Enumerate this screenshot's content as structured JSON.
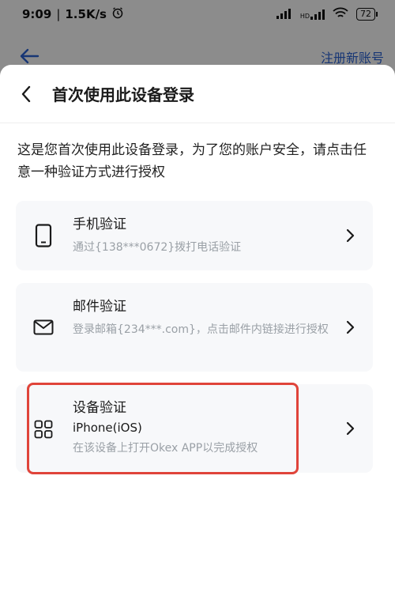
{
  "status_bar": {
    "time": "9:09",
    "speed": "1.5K/s",
    "battery": "72",
    "network": "HD"
  },
  "background": {
    "register_link": "注册新账号"
  },
  "sheet": {
    "title": "首次使用此设备登录",
    "description": "这是您首次使用此设备登录，为了您的账户安全，请点击任意一种验证方式进行授权",
    "options": [
      {
        "title": "手机验证",
        "subtitle": "通过{138***0672}拨打电话验证",
        "icon": "phone-icon"
      },
      {
        "title": "邮件验证",
        "subtitle": "登录邮箱{234***.com}，点击邮件内链接进行授权",
        "icon": "mail-icon"
      },
      {
        "title": "设备验证",
        "device": "iPhone(iOS)",
        "subtitle": "在该设备上打开Okex APP以完成授权",
        "icon": "grid-icon"
      }
    ]
  },
  "colors": {
    "accent": "#2a63d6",
    "highlight": "#e0443a",
    "card_bg": "#f7f8fa",
    "subtitle": "#9aa0a6"
  }
}
